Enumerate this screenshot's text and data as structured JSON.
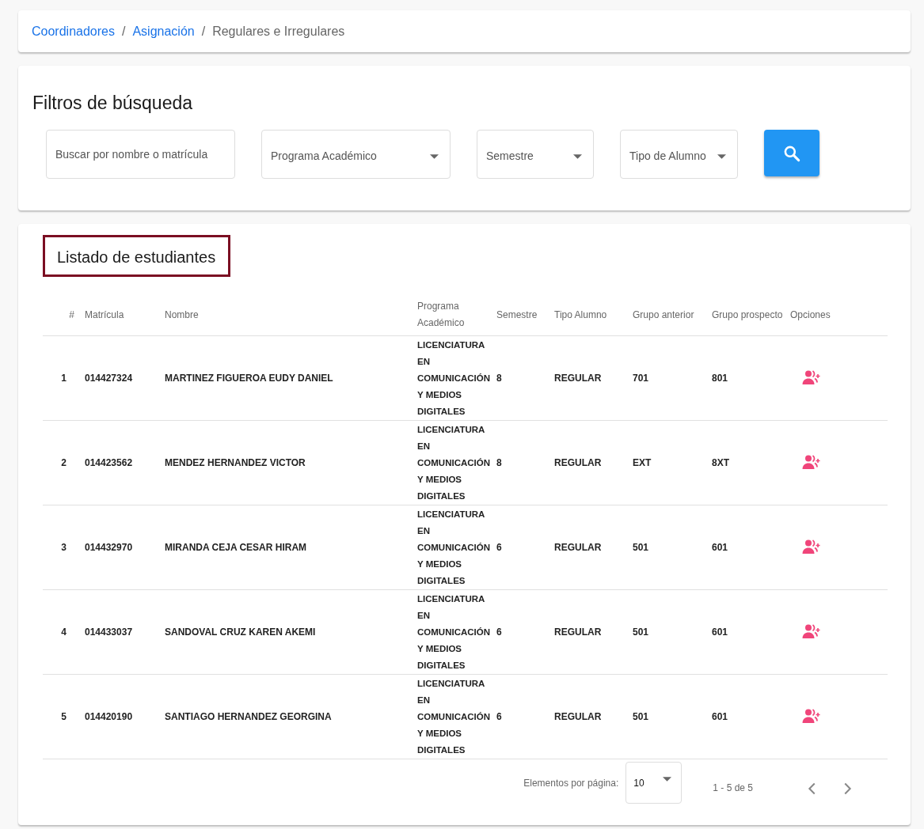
{
  "breadcrumb": [
    {
      "label": "Coordinadores",
      "kind": "link"
    },
    {
      "separator": "/",
      "label": "Asignación",
      "kind": "link"
    },
    {
      "separator": "/",
      "label": "Regulares e Irregulares",
      "kind": "current"
    }
  ],
  "filters": {
    "title": "Filtros de búsqueda",
    "controls": [
      {
        "kind": "input",
        "placeholder": "Buscar por nombre o matrícula"
      },
      {
        "kind": "select",
        "placeholder": "Programa Académico"
      },
      {
        "kind": "select",
        "placeholder": "Semestre"
      },
      {
        "kind": "select",
        "placeholder": "Tipo de Alumno"
      },
      {
        "kind": "search-button"
      }
    ]
  },
  "list": {
    "title": "Listado de estudiantes",
    "table": {
      "columns": [
        "#",
        "Matrícula",
        "Nombre",
        "Programa Académico",
        "Semestre",
        "Tipo Alumno",
        "Grupo anterior",
        "Grupo prospecto",
        "Opciones"
      ],
      "rows": [
        {
          "n": "1",
          "matricula": "014427324",
          "nombre": "MARTINEZ FIGUEROA EUDY DANIEL",
          "programa": "LICENCIATURA EN COMUNICACIÓN Y MEDIOS DIGITALES",
          "semestre": "8",
          "tipo": "REGULAR",
          "grupo_anterior": "701",
          "grupo_prospecto": "801"
        },
        {
          "n": "2",
          "matricula": "014423562",
          "nombre": "MENDEZ HERNANDEZ VICTOR",
          "programa": "LICENCIATURA EN COMUNICACIÓN Y MEDIOS DIGITALES",
          "semestre": "8",
          "tipo": "REGULAR",
          "grupo_anterior": "EXT",
          "grupo_prospecto": "8XT"
        },
        {
          "n": "3",
          "matricula": "014432970",
          "nombre": "MIRANDA CEJA CESAR HIRAM",
          "programa": "LICENCIATURA EN COMUNICACIÓN Y MEDIOS DIGITALES",
          "semestre": "6",
          "tipo": "REGULAR",
          "grupo_anterior": "501",
          "grupo_prospecto": "601"
        },
        {
          "n": "4",
          "matricula": "014433037",
          "nombre": "SANDOVAL CRUZ KAREN AKEMI",
          "programa": "LICENCIATURA EN COMUNICACIÓN Y MEDIOS DIGITALES",
          "semestre": "6",
          "tipo": "REGULAR",
          "grupo_anterior": "501",
          "grupo_prospecto": "601"
        },
        {
          "n": "5",
          "matricula": "014420190",
          "nombre": "SANTIAGO HERNANDEZ GEORGINA",
          "programa": "LICENCIATURA EN COMUNICACIÓN Y MEDIOS DIGITALES",
          "semestre": "6",
          "tipo": "REGULAR",
          "grupo_anterior": "501",
          "grupo_prospecto": "601"
        }
      ]
    },
    "paginator": {
      "label": "Elementos por página:",
      "page_size": "10",
      "range": "1 - 5 de 5"
    }
  }
}
